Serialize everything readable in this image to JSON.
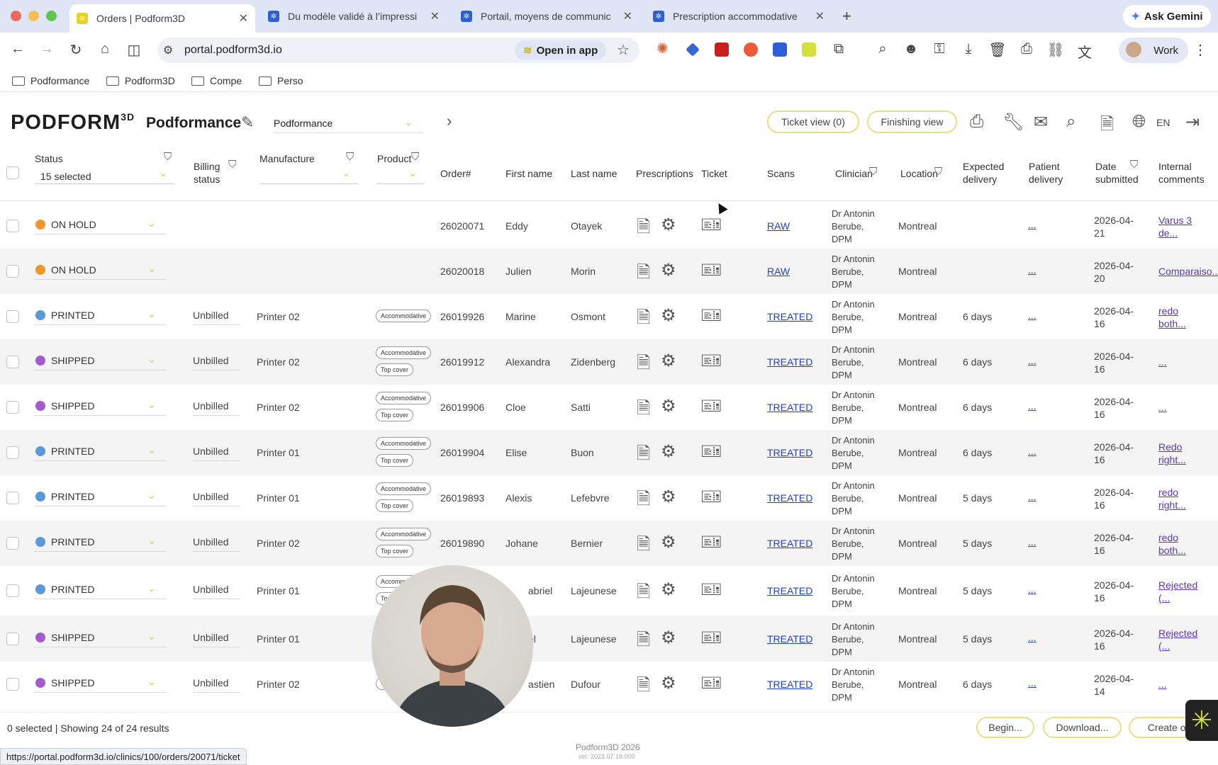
{
  "browser": {
    "tabs": [
      {
        "title": "Orders | Podform3D",
        "active": true
      },
      {
        "title": "Du modèle validé à l’impressi",
        "active": false
      },
      {
        "title": "Portail, moyens de communic",
        "active": false
      },
      {
        "title": "Prescription accommodative",
        "active": false
      }
    ],
    "ask_gemini": "Ask Gemini",
    "url": "portal.podform3d.io",
    "open_in_app": "Open in app",
    "profile": "Work",
    "bookmarks": [
      "Podformance",
      "Podform3D",
      "Compe",
      "Perso"
    ]
  },
  "app": {
    "logo_text": "PODFORM",
    "logo_sup": "3D",
    "brand": "Podformance",
    "org_select": "Podformance",
    "ticket_view": "Ticket view (0)",
    "finishing_view": "Finishing view",
    "lang": "EN"
  },
  "columns": {
    "status": "Status",
    "status_filter": "15 selected",
    "billing_1": "Billing",
    "billing_2": "status",
    "manufacture": "Manufacture",
    "product": "Product",
    "order": "Order#",
    "first": "First name",
    "last": "Last name",
    "prescriptions": "Prescriptions",
    "ticket": "Ticket",
    "scans": "Scans",
    "clinician": "Clinician",
    "location": "Location",
    "exp_1": "Expected",
    "exp_2": "delivery",
    "pat_1": "Patient",
    "pat_2": "delivery",
    "date_1": "Date",
    "date_2": "submitted",
    "int_1": "Internal",
    "int_2": "comments"
  },
  "colors": {
    "on_hold": "#f0962c",
    "printed": "#5a9ad8",
    "shipped": "#a65ad0",
    "accent": "#e4e08a"
  },
  "rows": [
    {
      "status": "ON HOLD",
      "billing": "",
      "manufacture": "",
      "tags": [],
      "order": "26020071",
      "first": "Eddy",
      "last": "Otayek",
      "scan": "RAW",
      "clin1": "Dr Antonin",
      "clin2": "Berube,",
      "clin3": "DPM",
      "location": "Montreal",
      "expected": "",
      "patient": "...",
      "date1": "2026-04-",
      "date2": "21",
      "comment1": "Varus 3",
      "comment2": "de..."
    },
    {
      "status": "ON HOLD",
      "billing": "",
      "manufacture": "",
      "tags": [],
      "order": "26020018",
      "first": "Julien",
      "last": "Morin",
      "scan": "RAW",
      "clin1": "Dr Antonin",
      "clin2": "Berube,",
      "clin3": "DPM",
      "location": "Montreal",
      "expected": "",
      "patient": "...",
      "date1": "2026-04-",
      "date2": "20",
      "comment1": "Comparaiso...",
      "comment2": ""
    },
    {
      "status": "PRINTED",
      "billing": "Unbilled",
      "manufacture": "Printer 02",
      "tags": [
        "Accommodative"
      ],
      "order": "26019926",
      "first": "Marine",
      "last": "Osmont",
      "scan": "TREATED",
      "clin1": "Dr Antonin",
      "clin2": "Berube,",
      "clin3": "DPM",
      "location": "Montreal",
      "expected": "6 days",
      "patient": "...",
      "date1": "2026-04-",
      "date2": "16",
      "comment1": "redo",
      "comment2": "both..."
    },
    {
      "status": "SHIPPED",
      "billing": "Unbilled",
      "manufacture": "Printer 02",
      "tags": [
        "Accommodative",
        "Top cover"
      ],
      "order": "26019912",
      "first": "Alexandra",
      "last": "Zidenberg",
      "scan": "TREATED",
      "clin1": "Dr Antonin",
      "clin2": "Berube,",
      "clin3": "DPM",
      "location": "Montreal",
      "expected": "6 days",
      "patient": "...",
      "date1": "2026-04-",
      "date2": "16",
      "comment1": "...",
      "comment2": ""
    },
    {
      "status": "SHIPPED",
      "billing": "Unbilled",
      "manufacture": "Printer 02",
      "tags": [
        "Accommodative",
        "Top cover"
      ],
      "order": "26019906",
      "first": "Cloe",
      "last": "Satti",
      "scan": "TREATED",
      "clin1": "Dr Antonin",
      "clin2": "Berube,",
      "clin3": "DPM",
      "location": "Montreal",
      "expected": "6 days",
      "patient": "...",
      "date1": "2026-04-",
      "date2": "16",
      "comment1": "...",
      "comment2": ""
    },
    {
      "status": "PRINTED",
      "billing": "Unbilled",
      "manufacture": "Printer 01",
      "tags": [
        "Accommodative",
        "Top cover"
      ],
      "order": "26019904",
      "first": "Elise",
      "last": "Buon",
      "scan": "TREATED",
      "clin1": "Dr Antonin",
      "clin2": "Berube,",
      "clin3": "DPM",
      "location": "Montreal",
      "expected": "6 days",
      "patient": "...",
      "date1": "2026-04-",
      "date2": "16",
      "comment1": "Redo",
      "comment2": "right..."
    },
    {
      "status": "PRINTED",
      "billing": "Unbilled",
      "manufacture": "Printer 01",
      "tags": [
        "Accommodative",
        "Top cover"
      ],
      "order": "26019893",
      "first": "Alexis",
      "last": "Lefebvre",
      "scan": "TREATED",
      "clin1": "Dr Antonin",
      "clin2": "Berube,",
      "clin3": "DPM",
      "location": "Montreal",
      "expected": "5 days",
      "patient": "...",
      "date1": "2026-04-",
      "date2": "16",
      "comment1": "redo",
      "comment2": "right..."
    },
    {
      "status": "PRINTED",
      "billing": "Unbilled",
      "manufacture": "Printer 02",
      "tags": [
        "Accommodative",
        "Top cover"
      ],
      "order": "26019890",
      "first": "Johane",
      "last": "Bernier",
      "scan": "TREATED",
      "clin1": "Dr Antonin",
      "clin2": "Berube,",
      "clin3": "DPM",
      "location": "Montreal",
      "expected": "5 days",
      "patient": "...",
      "date1": "2026-04-",
      "date2": "16",
      "comment1": "redo",
      "comment2": "both..."
    },
    {
      "status": "PRINTED",
      "billing": "Unbilled",
      "manufacture": "Printer 01",
      "tags": [
        "Accommodati",
        "Top"
      ],
      "order": "",
      "first": "abriel",
      "last": "Lajeunese",
      "scan": "TREATED",
      "clin1": "Dr Antonin",
      "clin2": "Berube,",
      "clin3": "DPM",
      "location": "Montreal",
      "expected": "5 days",
      "patient": "...",
      "date1": "2026-04-",
      "date2": "16",
      "comment1": "Rejected",
      "comment2": "(..."
    },
    {
      "status": "SHIPPED",
      "billing": "Unbilled",
      "manufacture": "Printer 01",
      "tags": [],
      "order": "",
      "first": "el",
      "last": "Lajeunese",
      "scan": "TREATED",
      "clin1": "Dr Antonin",
      "clin2": "Berube,",
      "clin3": "DPM",
      "location": "Montreal",
      "expected": "5 days",
      "patient": "...",
      "date1": "2026-04-",
      "date2": "16",
      "comment1": "Rejected",
      "comment2": "(..."
    },
    {
      "status": "SHIPPED",
      "billing": "Unbilled",
      "manufacture": "Printer 02",
      "tags": [
        "To"
      ],
      "order": "",
      "first": "astien",
      "last": "Dufour",
      "scan": "TREATED",
      "clin1": "Dr Antonin",
      "clin2": "Berube,",
      "clin3": "DPM",
      "location": "Montreal",
      "expected": "6 days",
      "patient": "...",
      "date1": "2026-04-",
      "date2": "14",
      "comment1": "...",
      "comment2": ""
    }
  ],
  "footer": {
    "summary": "0 selected | Showing 24 of 24 results",
    "begin": "Begin...",
    "download": "Download...",
    "create": "Create or",
    "copyright": "Podform3D 2026",
    "version": "ver. 2023.07.19.000",
    "status_url": "https://portal.podform3d.io/clinics/100/orders/20071/ticket"
  }
}
